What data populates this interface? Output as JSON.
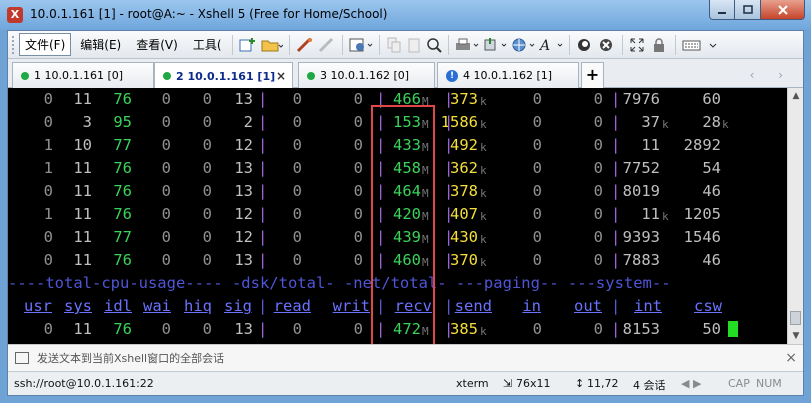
{
  "window": {
    "title": "10.0.1.161 [1] - root@A:~ - Xshell 5 (Free for Home/School)",
    "app_icon": "X"
  },
  "menu": {
    "items": [
      "文件(F)",
      "编辑(E)",
      "查看(V)",
      "工具("
    ]
  },
  "tabs": [
    {
      "label": "1 10.0.1.161 [0]",
      "status": "green-dot",
      "active": false
    },
    {
      "label": "2 10.0.1.161 [1]",
      "status": "green-dot",
      "active": true
    },
    {
      "label": "3 10.0.1.162 [0]",
      "status": "green-dot",
      "active": false
    },
    {
      "label": "4 10.0.1.162 [1]",
      "status": "info-icon",
      "active": false
    }
  ],
  "tab_close_glyph": "×",
  "tab_add_glyph": "+",
  "tab_nav": "‹ ›",
  "terminal": {
    "rows": [
      [
        "0",
        "11",
        "76",
        "0",
        "0",
        "13",
        "0",
        "0",
        "466",
        "373",
        "0",
        "0",
        "7976",
        "60"
      ],
      [
        "0",
        "3",
        "95",
        "0",
        "0",
        "2",
        "0",
        "0",
        "153",
        "1586",
        "0",
        "0",
        "37",
        "28"
      ],
      [
        "1",
        "10",
        "77",
        "0",
        "0",
        "12",
        "0",
        "0",
        "433",
        "492",
        "0",
        "0",
        "11",
        "2892"
      ],
      [
        "1",
        "11",
        "76",
        "0",
        "0",
        "13",
        "0",
        "0",
        "458",
        "362",
        "0",
        "0",
        "7752",
        "54"
      ],
      [
        "0",
        "11",
        "76",
        "0",
        "0",
        "13",
        "0",
        "0",
        "464",
        "378",
        "0",
        "0",
        "8019",
        "46"
      ],
      [
        "1",
        "11",
        "76",
        "0",
        "0",
        "12",
        "0",
        "0",
        "420",
        "407",
        "0",
        "0",
        "11",
        "1205"
      ],
      [
        "0",
        "11",
        "77",
        "0",
        "0",
        "12",
        "0",
        "0",
        "439",
        "430",
        "0",
        "0",
        "9393",
        "1546"
      ],
      [
        "0",
        "11",
        "76",
        "0",
        "0",
        "13",
        "0",
        "0",
        "460",
        "370",
        "0",
        "0",
        "7883",
        "46"
      ]
    ],
    "recv_units": [
      "M",
      "M",
      "M",
      "M",
      "M",
      "M",
      "M",
      "M"
    ],
    "send_units": [
      "k",
      "k",
      "k",
      "k",
      "k",
      "k",
      "k",
      "k"
    ],
    "int_units": [
      "",
      "k",
      "",
      "",
      "",
      "k",
      "",
      ""
    ],
    "csw_units": [
      "",
      "k",
      "",
      "",
      "",
      "",
      "",
      ""
    ],
    "group_header": "----total-cpu-usage---- -dsk/total- -net/total- ---paging-- ---system--",
    "column_headers": [
      "usr",
      "sys",
      "idl",
      "wai",
      "hiq",
      "sig",
      "read",
      "writ",
      "recv",
      "send",
      "in",
      "out",
      "int",
      "csw"
    ],
    "last_row": [
      "0",
      "11",
      "76",
      "0",
      "0",
      "13",
      "0",
      "0",
      "472",
      "385",
      "0",
      "0",
      "8153",
      "50"
    ],
    "last_recv_unit": "M",
    "last_send_unit": "k"
  },
  "compose": {
    "placeholder": "发送文本到当前Xshell窗口的全部会话"
  },
  "status": {
    "session": "ssh://root@10.0.1.161:22",
    "term": "xterm",
    "size": "76x11",
    "cursor": "11,72",
    "sessions": "4 会话",
    "caps": "CAP",
    "num": "NUM"
  },
  "colors": {
    "terminal_bg": "#000000",
    "green": "#39d35a",
    "yellow": "#f5df3a",
    "header_blue": "#4f55d6",
    "highlight": "#e04848"
  }
}
